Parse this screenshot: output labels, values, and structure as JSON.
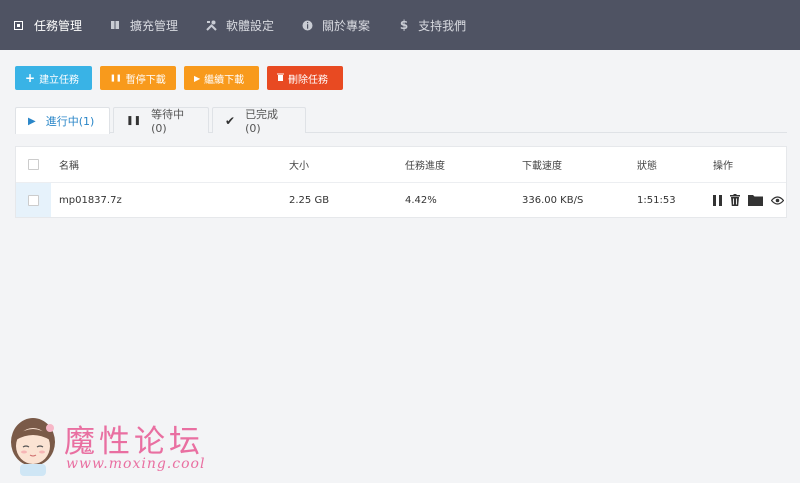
{
  "nav": {
    "items": [
      {
        "label": "任務管理",
        "icon": "task-square-icon"
      },
      {
        "label": "擴充管理",
        "icon": "book-icon"
      },
      {
        "label": "軟體設定",
        "icon": "tools-icon"
      },
      {
        "label": "關於專案",
        "icon": "info-circle-icon"
      },
      {
        "label": "支持我們",
        "icon": "dollar-icon"
      }
    ]
  },
  "actions": {
    "create": "建立任務",
    "pause": "暫停下載",
    "resume": "繼續下載",
    "delete": "刪除任務"
  },
  "tabs": [
    {
      "label": "進行中(1)",
      "icon": "play-icon",
      "active": true
    },
    {
      "label": "等待中(0)",
      "icon": "pause-icon",
      "active": false
    },
    {
      "label": "已完成(0)",
      "icon": "check-icon",
      "active": false
    }
  ],
  "table": {
    "headers": {
      "name": "名稱",
      "size": "大小",
      "progress": "任務進度",
      "speed": "下載速度",
      "status": "狀態",
      "ops": "操作"
    },
    "rows": [
      {
        "name": "mp01837.7z",
        "size": "2.25 GB",
        "progress": "4.42%",
        "speed": "336.00 KB/S",
        "status": "1:51:53"
      }
    ]
  },
  "watermark": {
    "title": "魔性论坛",
    "url": "www.moxing.cool"
  },
  "colors": {
    "nav_bg": "#4f5363",
    "create": "#39b3e6",
    "pause_resume": "#f89a1c",
    "delete": "#e84a22",
    "active_tab": "#2a86c8"
  }
}
